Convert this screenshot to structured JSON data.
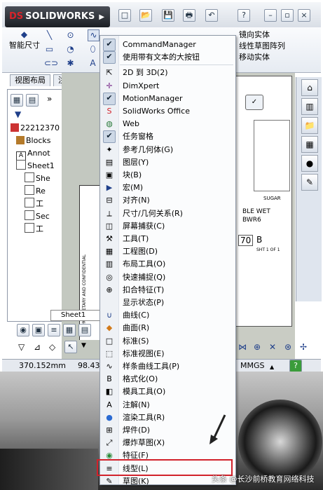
{
  "app": {
    "logo_text": "SOLIDWORKS",
    "logo_ds": "DS"
  },
  "commandmanager": {
    "smart_dimension_label": "智能尺寸",
    "right_labels": [
      "镜向实体",
      "线性草图阵列",
      "移动实体"
    ]
  },
  "tabs": [
    "视图布局",
    "注解",
    "草"
  ],
  "tree": {
    "items": [
      "22212370",
      "Blocks",
      "Annot",
      "Sheet1",
      "She",
      "Re",
      "工",
      "Sec",
      "工"
    ]
  },
  "sheet_tab": "Sheet1",
  "status": {
    "coord_x": "370.152mm",
    "coord_y": "98.43",
    "units": "MMGS",
    "help": "?"
  },
  "drawing": {
    "title_text": "BLE WET",
    "code_text": "BWR6",
    "num_text": "70",
    "rev_text": "B",
    "sheet_text": "SHT 1 OF 1",
    "sug_text": "SUGAR",
    "frame_text": "PROPRIETARY AND CONFIDENTIAL"
  },
  "menu": {
    "items": [
      {
        "label": "CommandManager",
        "icon": "check-icon",
        "checked": true
      },
      {
        "label": "使用带有文本的大按钮",
        "icon": "check-icon",
        "checked": true
      },
      {
        "label": "2D 到 3D(2)",
        "icon": "2d-to-3d-icon",
        "checked": false
      },
      {
        "label": "DimXpert",
        "icon": "dimxpert-icon",
        "checked": false
      },
      {
        "label": "MotionManager",
        "icon": "check-icon",
        "checked": true
      },
      {
        "label": "SolidWorks Office",
        "icon": "solidworks-office-icon",
        "checked": false
      },
      {
        "label": "Web",
        "icon": "web-globe-icon",
        "checked": false
      },
      {
        "label": "任务窗格",
        "icon": "check-icon",
        "checked": true
      },
      {
        "label": "参考几何体(G)",
        "icon": "reference-geometry-icon",
        "checked": false
      },
      {
        "label": "图层(Y)",
        "icon": "layer-icon",
        "checked": false
      },
      {
        "label": "块(B)",
        "icon": "block-icon",
        "checked": false
      },
      {
        "label": "宏(M)",
        "icon": "macro-icon",
        "checked": false
      },
      {
        "label": "对齐(N)",
        "icon": "align-icon",
        "checked": false
      },
      {
        "label": "尺寸/几何关系(R)",
        "icon": "dimension-relation-icon",
        "checked": false
      },
      {
        "label": "屏幕捕获(C)",
        "icon": "screen-capture-icon",
        "checked": false
      },
      {
        "label": "工具(T)",
        "icon": "tools-icon",
        "checked": false
      },
      {
        "label": "工程图(D)",
        "icon": "drawing-icon",
        "checked": false
      },
      {
        "label": "布局工具(O)",
        "icon": "layout-tools-icon",
        "checked": false
      },
      {
        "label": "快速捕捉(Q)",
        "icon": "quick-snap-icon",
        "checked": false
      },
      {
        "label": "扣合特征(T)",
        "icon": "fastening-feature-icon",
        "checked": false
      },
      {
        "label": "显示状态(P)",
        "icon": "",
        "checked": false
      },
      {
        "label": "曲线(C)",
        "icon": "curve-icon",
        "checked": false
      },
      {
        "label": "曲面(R)",
        "icon": "surface-icon",
        "checked": false
      },
      {
        "label": "标准(S)",
        "icon": "standard-icon",
        "checked": false
      },
      {
        "label": "标准视图(E)",
        "icon": "standard-views-icon",
        "checked": false
      },
      {
        "label": "样条曲线工具(P)",
        "icon": "spline-tools-icon",
        "checked": false
      },
      {
        "label": "格式化(O)",
        "icon": "format-icon",
        "checked": false
      },
      {
        "label": "模具工具(O)",
        "icon": "mold-tools-icon",
        "checked": false
      },
      {
        "label": "注解(N)",
        "icon": "annotation-icon",
        "checked": false
      },
      {
        "label": "渲染工具(R)",
        "icon": "render-tools-icon",
        "checked": false
      },
      {
        "label": "焊件(D)",
        "icon": "weldment-icon",
        "checked": false
      },
      {
        "label": "爆炸草图(X)",
        "icon": "explode-sketch-icon",
        "checked": false
      },
      {
        "label": "特征(F)",
        "icon": "features-icon",
        "checked": false
      },
      {
        "label": "线型(L)",
        "icon": "line-format-icon",
        "checked": false
      },
      {
        "label": "草图(K)",
        "icon": "sketch-icon",
        "checked": false
      }
    ]
  },
  "watermark": "头条 @长沙前桥教育网络科技",
  "colors": {
    "highlight": "#d2222b",
    "menu_bg": "#fbfcfd",
    "accent": "#1f3f8a"
  }
}
